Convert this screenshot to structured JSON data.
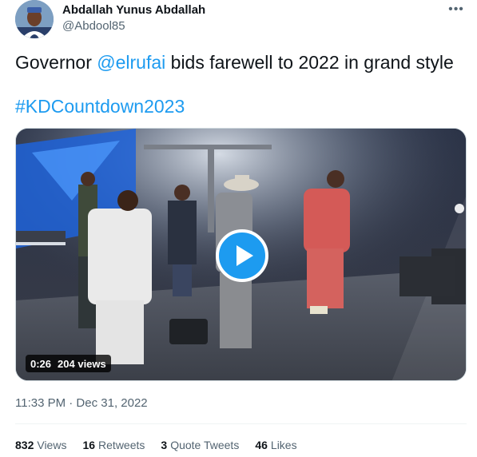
{
  "author": {
    "name": "Abdallah Yunus Abdallah",
    "handle": "@Abdool85"
  },
  "tweet": {
    "text_before": "Governor ",
    "mention": "@elrufai",
    "text_after": " bids farewell to 2022 in grand style",
    "hashtag": "#KDCountdown2023"
  },
  "media": {
    "duration": "0:26",
    "views": "204 views"
  },
  "meta": {
    "timestamp": "11:33 PM · Dec 31, 2022"
  },
  "stats": [
    {
      "count": "832",
      "label": "Views"
    },
    {
      "count": "16",
      "label": "Retweets"
    },
    {
      "count": "3",
      "label": "Quote Tweets"
    },
    {
      "count": "46",
      "label": "Likes"
    }
  ],
  "icons": {
    "more": "more-horizontal-icon",
    "play": "play-icon"
  },
  "colors": {
    "link": "#1d9bf0",
    "muted": "#536471",
    "text": "#0f1419"
  }
}
